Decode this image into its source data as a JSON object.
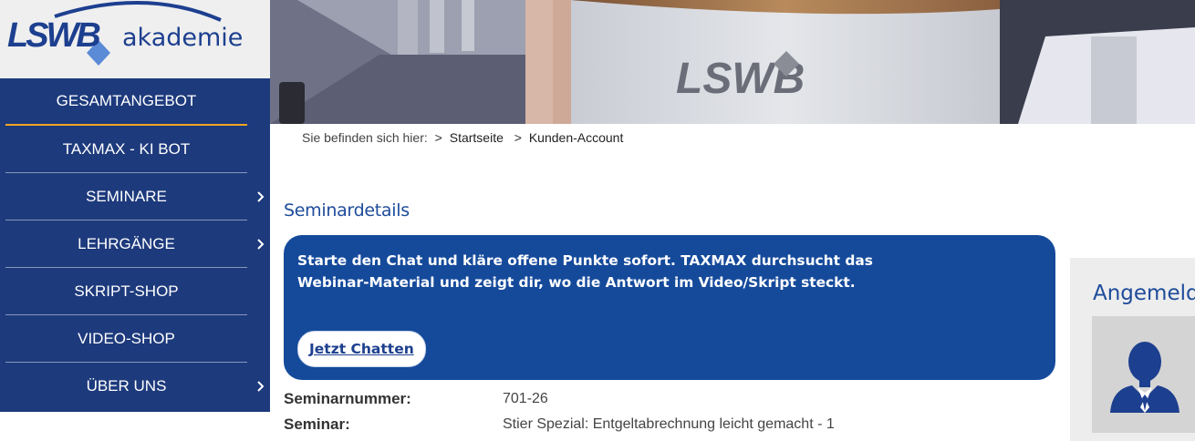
{
  "logo": {
    "brand": "LSWB",
    "sub": "akademie",
    "colors": {
      "primary": "#1d3f8f",
      "secondary": "#5b8bd6"
    }
  },
  "hero": {
    "sign_text": "LSWB"
  },
  "nav": {
    "items": [
      {
        "label": "GESAMTANGEBOT",
        "has_submenu": false,
        "active": true
      },
      {
        "label": "TAXMAX - KI BOT",
        "has_submenu": false
      },
      {
        "label": "SEMINARE",
        "has_submenu": true,
        "chevron_icon": "chevron-right-icon"
      },
      {
        "label": "LEHRGÄNGE",
        "has_submenu": true,
        "chevron_icon": "chevron-right-icon"
      },
      {
        "label": "SKRIPT-SHOP",
        "has_submenu": false
      },
      {
        "label": "VIDEO-SHOP",
        "has_submenu": false
      },
      {
        "label": "ÜBER UNS",
        "has_submenu": true,
        "chevron_icon": "chevron-right-icon"
      }
    ],
    "colors": {
      "background": "#1d3a7c",
      "active_underline": "#f0a71e"
    }
  },
  "breadcrumb": {
    "lead": "Sie befinden sich hier:",
    "separator": ">",
    "items": [
      "Startseite",
      "Kunden-Account"
    ]
  },
  "page": {
    "section_title": "Seminardetails"
  },
  "chat": {
    "message_line1": "Starte den Chat und kläre offene Punkte sofort. TAXMAX durchsucht das",
    "message_line2": "Webinar-Material und zeigt dir, wo die Antwort im Video/Skript steckt.",
    "button_label": "Jetzt Chatten",
    "colors": {
      "background": "#154a9b"
    }
  },
  "details": {
    "rows": [
      {
        "label": "Seminarnummer:",
        "value": "701-26"
      },
      {
        "label": "Seminar:",
        "value": "Stier Spezial: Entgeltabrechnung leicht gemacht - 1"
      }
    ]
  },
  "login": {
    "title": "Angemelde",
    "avatar_icon": "user-avatar-icon"
  }
}
